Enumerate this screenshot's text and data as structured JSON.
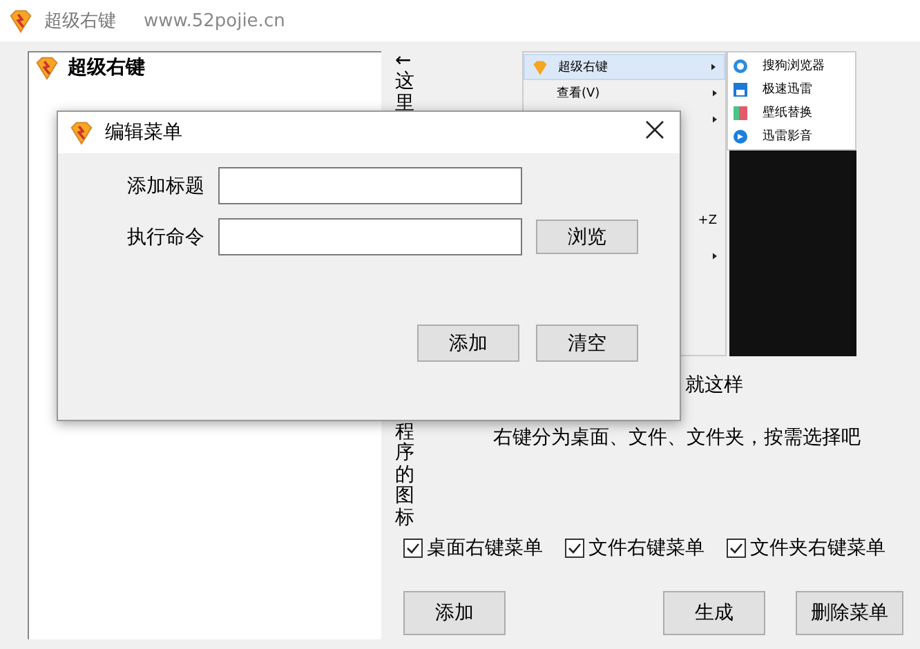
{
  "window": {
    "title": "超级右键",
    "subtitle": "www.52pojie.cn"
  },
  "list_panel": {
    "title": "超级右键"
  },
  "vertical_hint_top": "←这里",
  "vertical_hint_bottom": "程序的图标",
  "preview": {
    "menu_items": [
      {
        "label": "超级右键",
        "arrow": true,
        "selected": true
      },
      {
        "label": "查看(V)",
        "arrow": true,
        "selected": false
      },
      {
        "arrow": true,
        "selected": false
      },
      {
        "shortcut": "+Z",
        "arrow": false,
        "selected": false
      },
      {
        "arrow": true,
        "selected": false
      }
    ],
    "submenu_items": [
      {
        "label": "搜狗浏览器"
      },
      {
        "label": "极速迅雷"
      },
      {
        "label": "壁纸替换"
      },
      {
        "label": "迅雷影音"
      }
    ]
  },
  "caption": "就这样",
  "note": "右键分为桌面、文件、文件夹，按需选择吧",
  "checkboxes": [
    {
      "label": "桌面右键菜单",
      "checked": true
    },
    {
      "label": "文件右键菜单",
      "checked": true
    },
    {
      "label": "文件夹右键菜单",
      "checked": true
    }
  ],
  "buttons": [
    {
      "label": "添加"
    },
    {
      "label": "生成"
    },
    {
      "label": "删除菜单"
    }
  ],
  "dialog": {
    "title": "编辑菜单",
    "fields": [
      {
        "label": "添加标题"
      },
      {
        "label": "执行命令",
        "browse": "浏览"
      }
    ],
    "buttons": [
      {
        "label": "添加"
      },
      {
        "label": "清空"
      }
    ]
  }
}
